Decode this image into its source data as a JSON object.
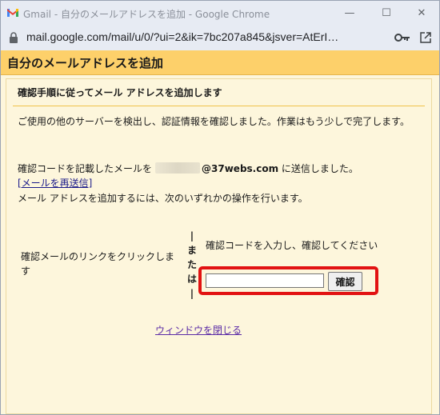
{
  "window": {
    "title": "Gmail - 自分のメールアドレスを追加 - Google Chrome",
    "url": "mail.google.com/mail/u/0/?ui=2&ik=7bc207a845&jsver=AtErI…",
    "minimize_glyph": "—",
    "maximize_glyph": "☐",
    "close_glyph": "✕"
  },
  "header": {
    "title": "自分のメールアドレスを追加"
  },
  "panel": {
    "subtitle": "確認手順に従ってメール アドレスを追加します",
    "intro": "ご使用の他のサーバーを検出し、認証情報を確認しました。作業はもう少しで完了します。",
    "sent_prefix": "確認コードを記載したメールを",
    "email_domain": "@37webs.com",
    "sent_suffix": " に送信しました。",
    "resend_link": "[メールを再送信]",
    "instruction": "メール アドレスを追加するには、次のいずれかの操作を行います。",
    "option_click": "確認メールのリンクをクリックします",
    "or_separator": [
      "|",
      "ま",
      "た",
      "は",
      "|"
    ],
    "option_code": "確認コードを入力し、確認してください",
    "code_input_value": "",
    "confirm_button": "確認",
    "close_link": "ウィンドウを閉じる"
  },
  "colors": {
    "header_bg": "#fdd06a",
    "panel_bg": "#fdf6dc",
    "highlight": "#e21212",
    "chrome_bg": "#e7ebf3"
  }
}
